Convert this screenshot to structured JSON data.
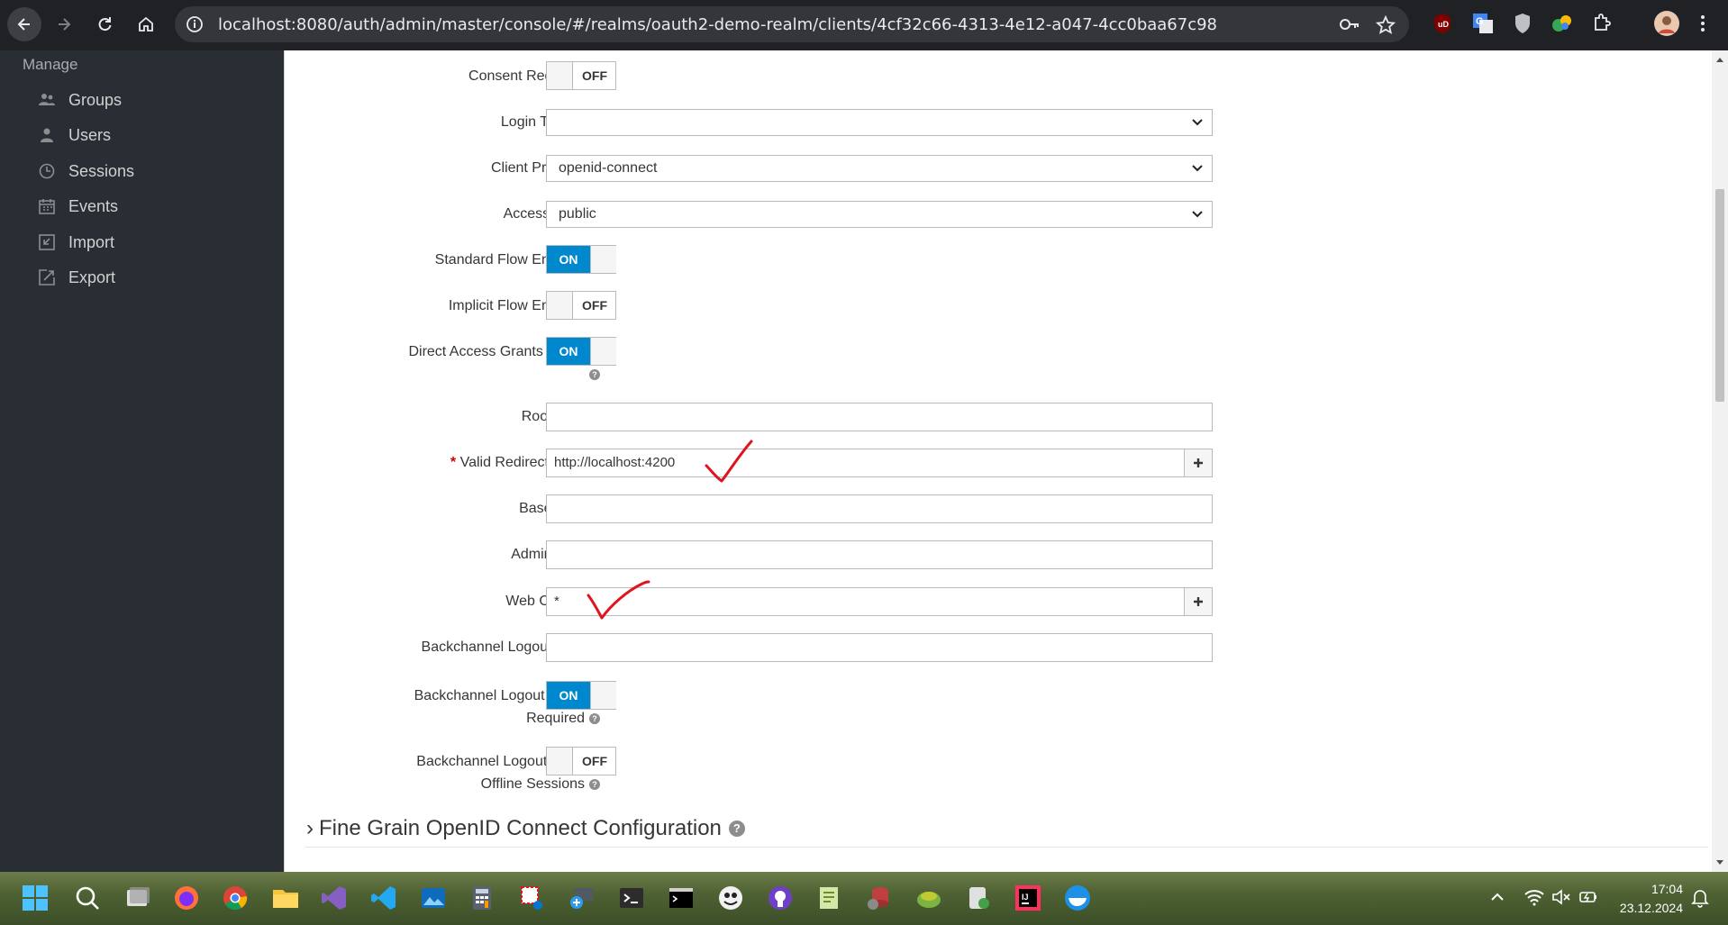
{
  "browser": {
    "url": "localhost:8080/auth/admin/master/console/#/realms/oauth2-demo-realm/clients/4cf32c66-4313-4e12-a047-4cc0baa67c98"
  },
  "sidebar": {
    "heading": "Manage",
    "items": [
      {
        "label": "Groups",
        "icon": "groups-icon"
      },
      {
        "label": "Users",
        "icon": "user-icon"
      },
      {
        "label": "Sessions",
        "icon": "clock-icon"
      },
      {
        "label": "Events",
        "icon": "calendar-icon"
      },
      {
        "label": "Import",
        "icon": "import-icon"
      },
      {
        "label": "Export",
        "icon": "export-icon"
      }
    ]
  },
  "form": {
    "consent_required": {
      "label": "Consent Required",
      "state": "OFF"
    },
    "login_theme": {
      "label": "Login Theme",
      "value": ""
    },
    "client_protocol": {
      "label": "Client Protocol",
      "value": "openid-connect"
    },
    "access_type": {
      "label": "Access Type",
      "value": "public"
    },
    "standard_flow": {
      "label": "Standard Flow Enabled",
      "state": "ON"
    },
    "implicit_flow": {
      "label": "Implicit Flow Enabled",
      "state": "OFF"
    },
    "direct_access": {
      "label": "Direct Access Grants Enabled",
      "state": "ON"
    },
    "root_url": {
      "label": "Root URL",
      "value": ""
    },
    "valid_redirect": {
      "label": "Valid Redirect URIs",
      "required_mark": "*",
      "value": "http://localhost:4200"
    },
    "base_url": {
      "label": "Base URL",
      "value": ""
    },
    "admin_url": {
      "label": "Admin URL",
      "value": ""
    },
    "web_origins": {
      "label": "Web Origins",
      "value": "*"
    },
    "backchannel_url": {
      "label": "Backchannel Logout URL",
      "value": ""
    },
    "backchannel_session": {
      "label_line1": "Backchannel Logout Session",
      "label_line2": "Required",
      "state": "ON"
    },
    "backchannel_revoke": {
      "label_line1": "Backchannel Logout Revoke",
      "label_line2": "Offline Sessions",
      "state": "OFF"
    },
    "help_glyph": "?",
    "fine_grain": {
      "chevron": "›",
      "title": "Fine Grain OpenID Connect Configuration"
    }
  },
  "taskbar": {
    "time": "17:04",
    "date": "23.12.2024"
  },
  "colors": {
    "toggle_on": "#0088ce",
    "sidebar_bg": "#292e34",
    "annotation": "#e0141e"
  }
}
